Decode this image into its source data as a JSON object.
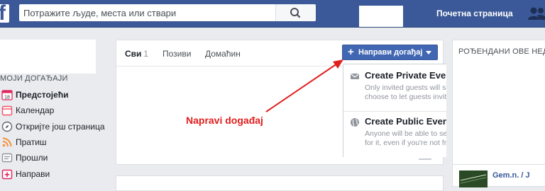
{
  "topbar": {
    "search_placeholder": "Потражите људе, места или ствари",
    "home_link": "Почетна страница",
    "icons": [
      "facebook-logo",
      "search-icon",
      "friends-icon"
    ]
  },
  "left_nav": {
    "section_title": "МОЈИ ДОГАЂАЈИ",
    "items": [
      {
        "label": "Предстојећи",
        "icon": "calendar-18-icon",
        "active": true
      },
      {
        "label": "Календар",
        "icon": "calendar-icon",
        "active": false
      },
      {
        "label": "Откријте још страница",
        "icon": "compass-icon",
        "active": false
      },
      {
        "label": "Пратиш",
        "icon": "rss-icon",
        "active": false
      },
      {
        "label": "Прошли",
        "icon": "history-icon",
        "active": false
      },
      {
        "label": "Направи",
        "icon": "create-icon",
        "active": false
      }
    ]
  },
  "main": {
    "tabs": [
      {
        "label": "Сви",
        "count": "1",
        "active": true
      },
      {
        "label": "Позиви",
        "count": "",
        "active": false
      },
      {
        "label": "Домаћин",
        "count": "",
        "active": false
      }
    ],
    "create_button": "Направи догађај"
  },
  "dropdown": {
    "items": [
      {
        "title": "Create Private Event",
        "description": "Only invited guests will see your event. You can choose to let guests invite friends",
        "icon": "envelope-icon"
      },
      {
        "title": "Create Public Event",
        "description": "Anyone will be able to see your event and search for it, even if you're not friends",
        "icon": "globe-icon"
      }
    ]
  },
  "right": {
    "title": "РОЂЕНДАНИ ОВЕ НЕДЕ",
    "item_text": "Gem.n. / J"
  },
  "annotation": {
    "text": "Napravi događaj",
    "color": "#e0201e"
  },
  "colors": {
    "brand": "#3b5998",
    "button": "#4267b2",
    "background": "#e9ebee"
  }
}
